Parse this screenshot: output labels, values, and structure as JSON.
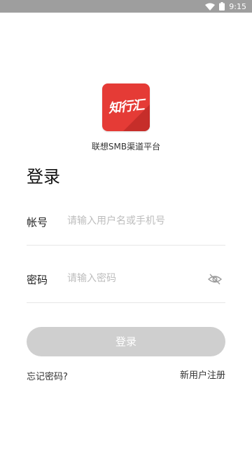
{
  "status_bar": {
    "time": "9:15",
    "wifi_icon": "wifi-icon",
    "battery_icon": "battery-icon",
    "background_color": "#9e9e9e"
  },
  "brand": {
    "logo_text": "知行汇",
    "platform_name": "联想SMB渠道平台",
    "logo_color": "#e53b36"
  },
  "page": {
    "title": "登录"
  },
  "form": {
    "account": {
      "label": "帐号",
      "placeholder": "请输入用户名或手机号",
      "value": ""
    },
    "password": {
      "label": "密码",
      "placeholder": "请输入密码",
      "value": "",
      "visibility_icon": "eye-off-icon"
    }
  },
  "actions": {
    "login_label": "登录",
    "forgot_password": "忘记密码?",
    "register": "新用户注册",
    "button_color": "#cfcfcf"
  }
}
